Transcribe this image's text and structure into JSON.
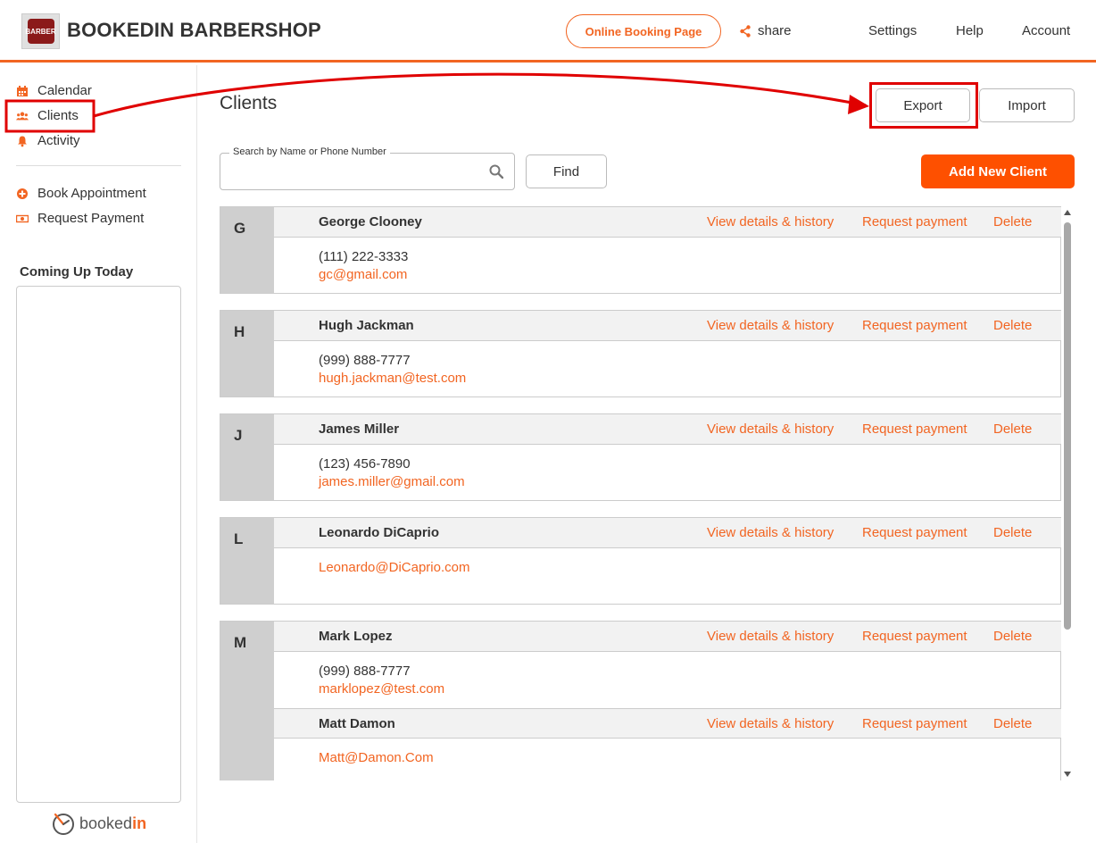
{
  "header": {
    "shop_name": "BOOKEDIN BARBERSHOP",
    "logo_text": "BARBER",
    "online_booking": "Online Booking Page",
    "share": "share",
    "settings": "Settings",
    "help": "Help",
    "account": "Account"
  },
  "sidebar": {
    "items": [
      {
        "label": "Calendar",
        "icon": "calendar-icon"
      },
      {
        "label": "Clients",
        "icon": "users-icon"
      },
      {
        "label": "Activity",
        "icon": "bell-icon"
      }
    ],
    "actions": [
      {
        "label": "Book Appointment",
        "icon": "plus-circle-icon"
      },
      {
        "label": "Request Payment",
        "icon": "money-icon"
      }
    ],
    "coming_up_title": "Coming Up Today",
    "footer_logo": {
      "prefix": "booked",
      "suffix": "in"
    }
  },
  "main": {
    "title": "Clients",
    "export_label": "Export",
    "import_label": "Import",
    "search": {
      "label": "Search by Name or Phone Number",
      "value": "",
      "placeholder": ""
    },
    "find_label": "Find",
    "add_label": "Add New Client",
    "link_labels": {
      "details": "View details & history",
      "payment": "Request payment",
      "delete": "Delete"
    },
    "groups": [
      {
        "letter": "G",
        "clients": [
          {
            "name": "George Clooney",
            "phone": "(111) 222-3333",
            "email": "gc@gmail.com"
          }
        ]
      },
      {
        "letter": "H",
        "clients": [
          {
            "name": "Hugh Jackman",
            "phone": "(999) 888-7777",
            "email": "hugh.jackman@test.com"
          }
        ]
      },
      {
        "letter": "J",
        "clients": [
          {
            "name": "James Miller",
            "phone": "(123) 456-7890",
            "email": "james.miller@gmail.com"
          }
        ]
      },
      {
        "letter": "L",
        "clients": [
          {
            "name": "Leonardo DiCaprio",
            "phone": "",
            "email": "Leonardo@DiCaprio.com"
          }
        ]
      },
      {
        "letter": "M",
        "clients": [
          {
            "name": "Mark Lopez",
            "phone": "(999) 888-7777",
            "email": "marklopez@test.com"
          },
          {
            "name": "Matt Damon",
            "phone": "",
            "email": "Matt@Damon.Com"
          }
        ]
      }
    ]
  },
  "colors": {
    "accent": "#f26522",
    "button": "#fe5000",
    "annotation": "#e00000",
    "letter_bg": "#cfcfcf"
  }
}
